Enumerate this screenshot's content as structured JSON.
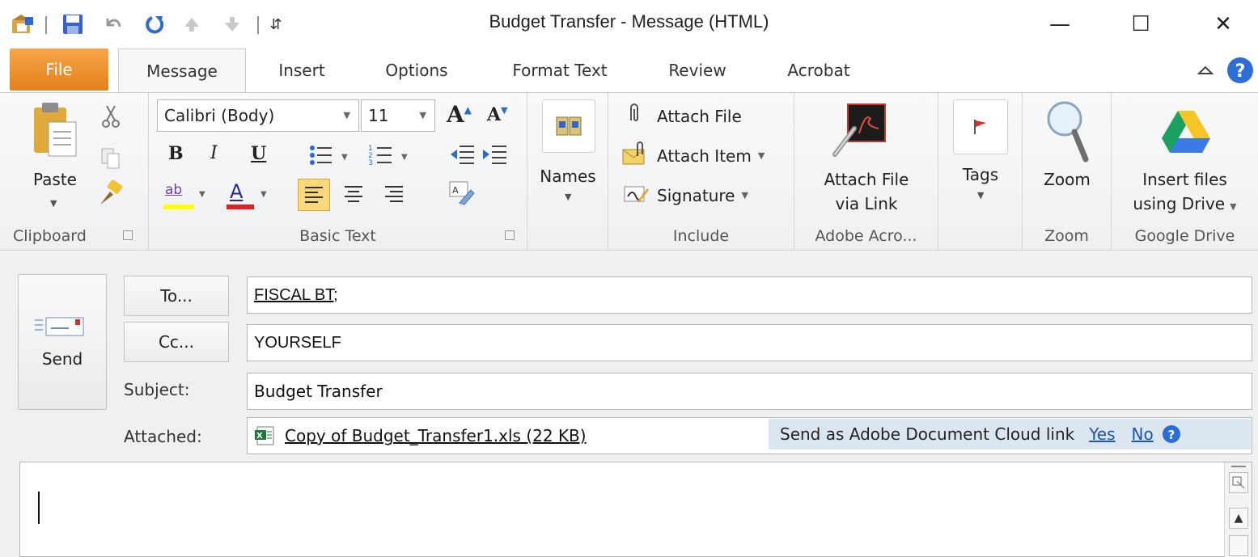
{
  "window": {
    "title": "Budget Transfer  -  Message (HTML)",
    "minimize": "—",
    "maximize": "☐",
    "close": "✕"
  },
  "quick_access": {
    "separator": "|",
    "customize": "⇵"
  },
  "tabs": [
    {
      "label": "File"
    },
    {
      "label": "Message"
    },
    {
      "label": "Insert"
    },
    {
      "label": "Options"
    },
    {
      "label": "Format Text"
    },
    {
      "label": "Review"
    },
    {
      "label": "Acrobat"
    }
  ],
  "ribbon": {
    "clipboard": {
      "paste_label": "Paste",
      "group_label": "Clipboard"
    },
    "basic_text": {
      "font_name": "Calibri (Body)",
      "font_size": "11",
      "bold": "B",
      "italic": "I",
      "underline": "U",
      "grow_font": "A",
      "shrink_font": "A",
      "highlight": "ab",
      "font_color": "A",
      "group_label": "Basic Text"
    },
    "names": {
      "label": "Names"
    },
    "include": {
      "attach_file": "Attach File",
      "attach_item": "Attach Item",
      "signature": "Signature",
      "group_label": "Include"
    },
    "adobe": {
      "attach_link_line1": "Attach File",
      "attach_link_line2": "via Link",
      "group_label": "Adobe Acro..."
    },
    "tags": {
      "label": "Tags"
    },
    "zoom": {
      "label": "Zoom",
      "group_label": "Zoom"
    },
    "drive": {
      "line1": "Insert files",
      "line2": "using Drive",
      "group_label": "Google Drive"
    }
  },
  "message": {
    "send_label": "Send",
    "to_button": "To...",
    "cc_button": "Cc...",
    "to_value": "FISCAL BT;",
    "cc_value": "YOURSELF",
    "subject_label": "Subject:",
    "subject_value": "Budget Transfer",
    "attached_label": "Attached:",
    "attachment": "Copy of Budget_Transfer1.xls (22 KB)",
    "adobe_prompt": "Send as Adobe Document Cloud link",
    "adobe_yes": "Yes",
    "adobe_no": "No"
  },
  "colors": {
    "file_tab": "#e8861f",
    "highlight_bar": "#ffff00",
    "font_color_bar": "#e02020",
    "adobe_bar": "#dbe6f1",
    "link": "#1a56b8"
  }
}
